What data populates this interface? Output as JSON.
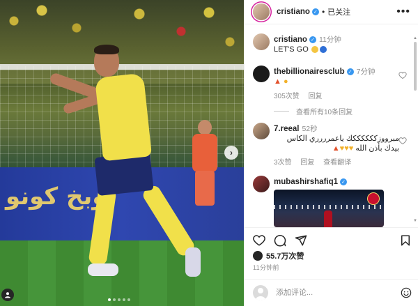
{
  "photo": {
    "ad_text": "وبخ كونو"
  },
  "header": {
    "username": "cristiano",
    "verified_mark": "✓",
    "follow_state": "已关注",
    "more_icon": "more-dots-icon"
  },
  "post": {
    "author": "cristiano",
    "time": "11分钟",
    "caption": "LET'S GO"
  },
  "comments": [
    {
      "user": "thebillionairesclub",
      "time": "7分钟",
      "text_emoji": [
        "fire-emoji",
        "muscle-emoji"
      ],
      "likes": "305次赞",
      "reply": "回复",
      "view_replies": "查看所有10条回复"
    },
    {
      "user": "7.reeal",
      "time": "52秒",
      "text_line1": "مبرووزككككككك ياعمرررري الكاس",
      "text_line2": "بيدك بأذن الله",
      "likes": "3次赞",
      "reply": "回复",
      "translate": "查看翻译"
    },
    {
      "user": "mubashirshafiq1"
    }
  ],
  "engagement": {
    "likes": "55.7万次赞",
    "posted_ago": "11分钟前"
  },
  "composer": {
    "placeholder": "添加评论..."
  },
  "colors": {
    "verified": "#3897f0",
    "muted": "#8e8e8e",
    "story_ring": "#d6249f"
  }
}
